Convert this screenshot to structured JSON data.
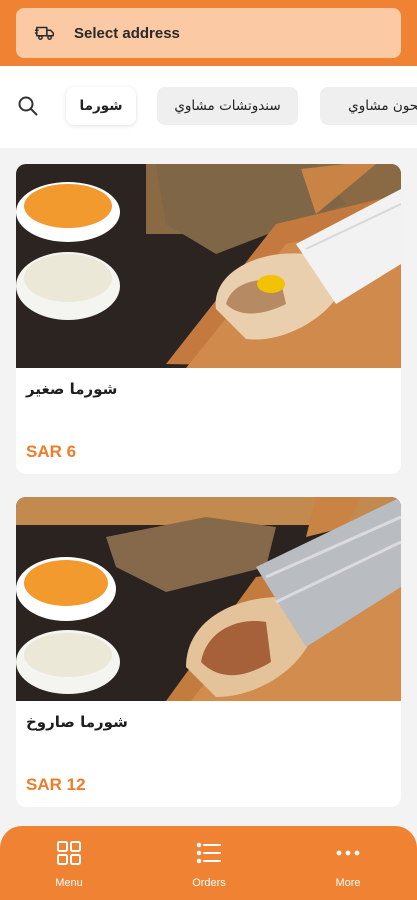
{
  "header": {
    "address_label": "Select address",
    "truck_icon": "delivery-truck-icon",
    "search_icon": "search-icon"
  },
  "categories": [
    {
      "label": "شورما",
      "active": true
    },
    {
      "label": "سندوتشات مشاوي",
      "active": false
    },
    {
      "label": "صحون مشاوي",
      "active": false
    }
  ],
  "menu_items": [
    {
      "name": "شورما صغير",
      "price": "SAR 6",
      "image": "shawarma-wrap-with-sauces"
    },
    {
      "name": "شورما صاروخ",
      "price": "SAR 12",
      "image": "shawarma-rocket-wrap-with-sauces"
    }
  ],
  "bottom_nav": [
    {
      "label": "Menu",
      "icon": "grid-icon"
    },
    {
      "label": "Orders",
      "icon": "list-icon"
    },
    {
      "label": "More",
      "icon": "more-dots-icon"
    }
  ],
  "colors": {
    "accent": "#f08333",
    "price": "#ef7c2a"
  }
}
